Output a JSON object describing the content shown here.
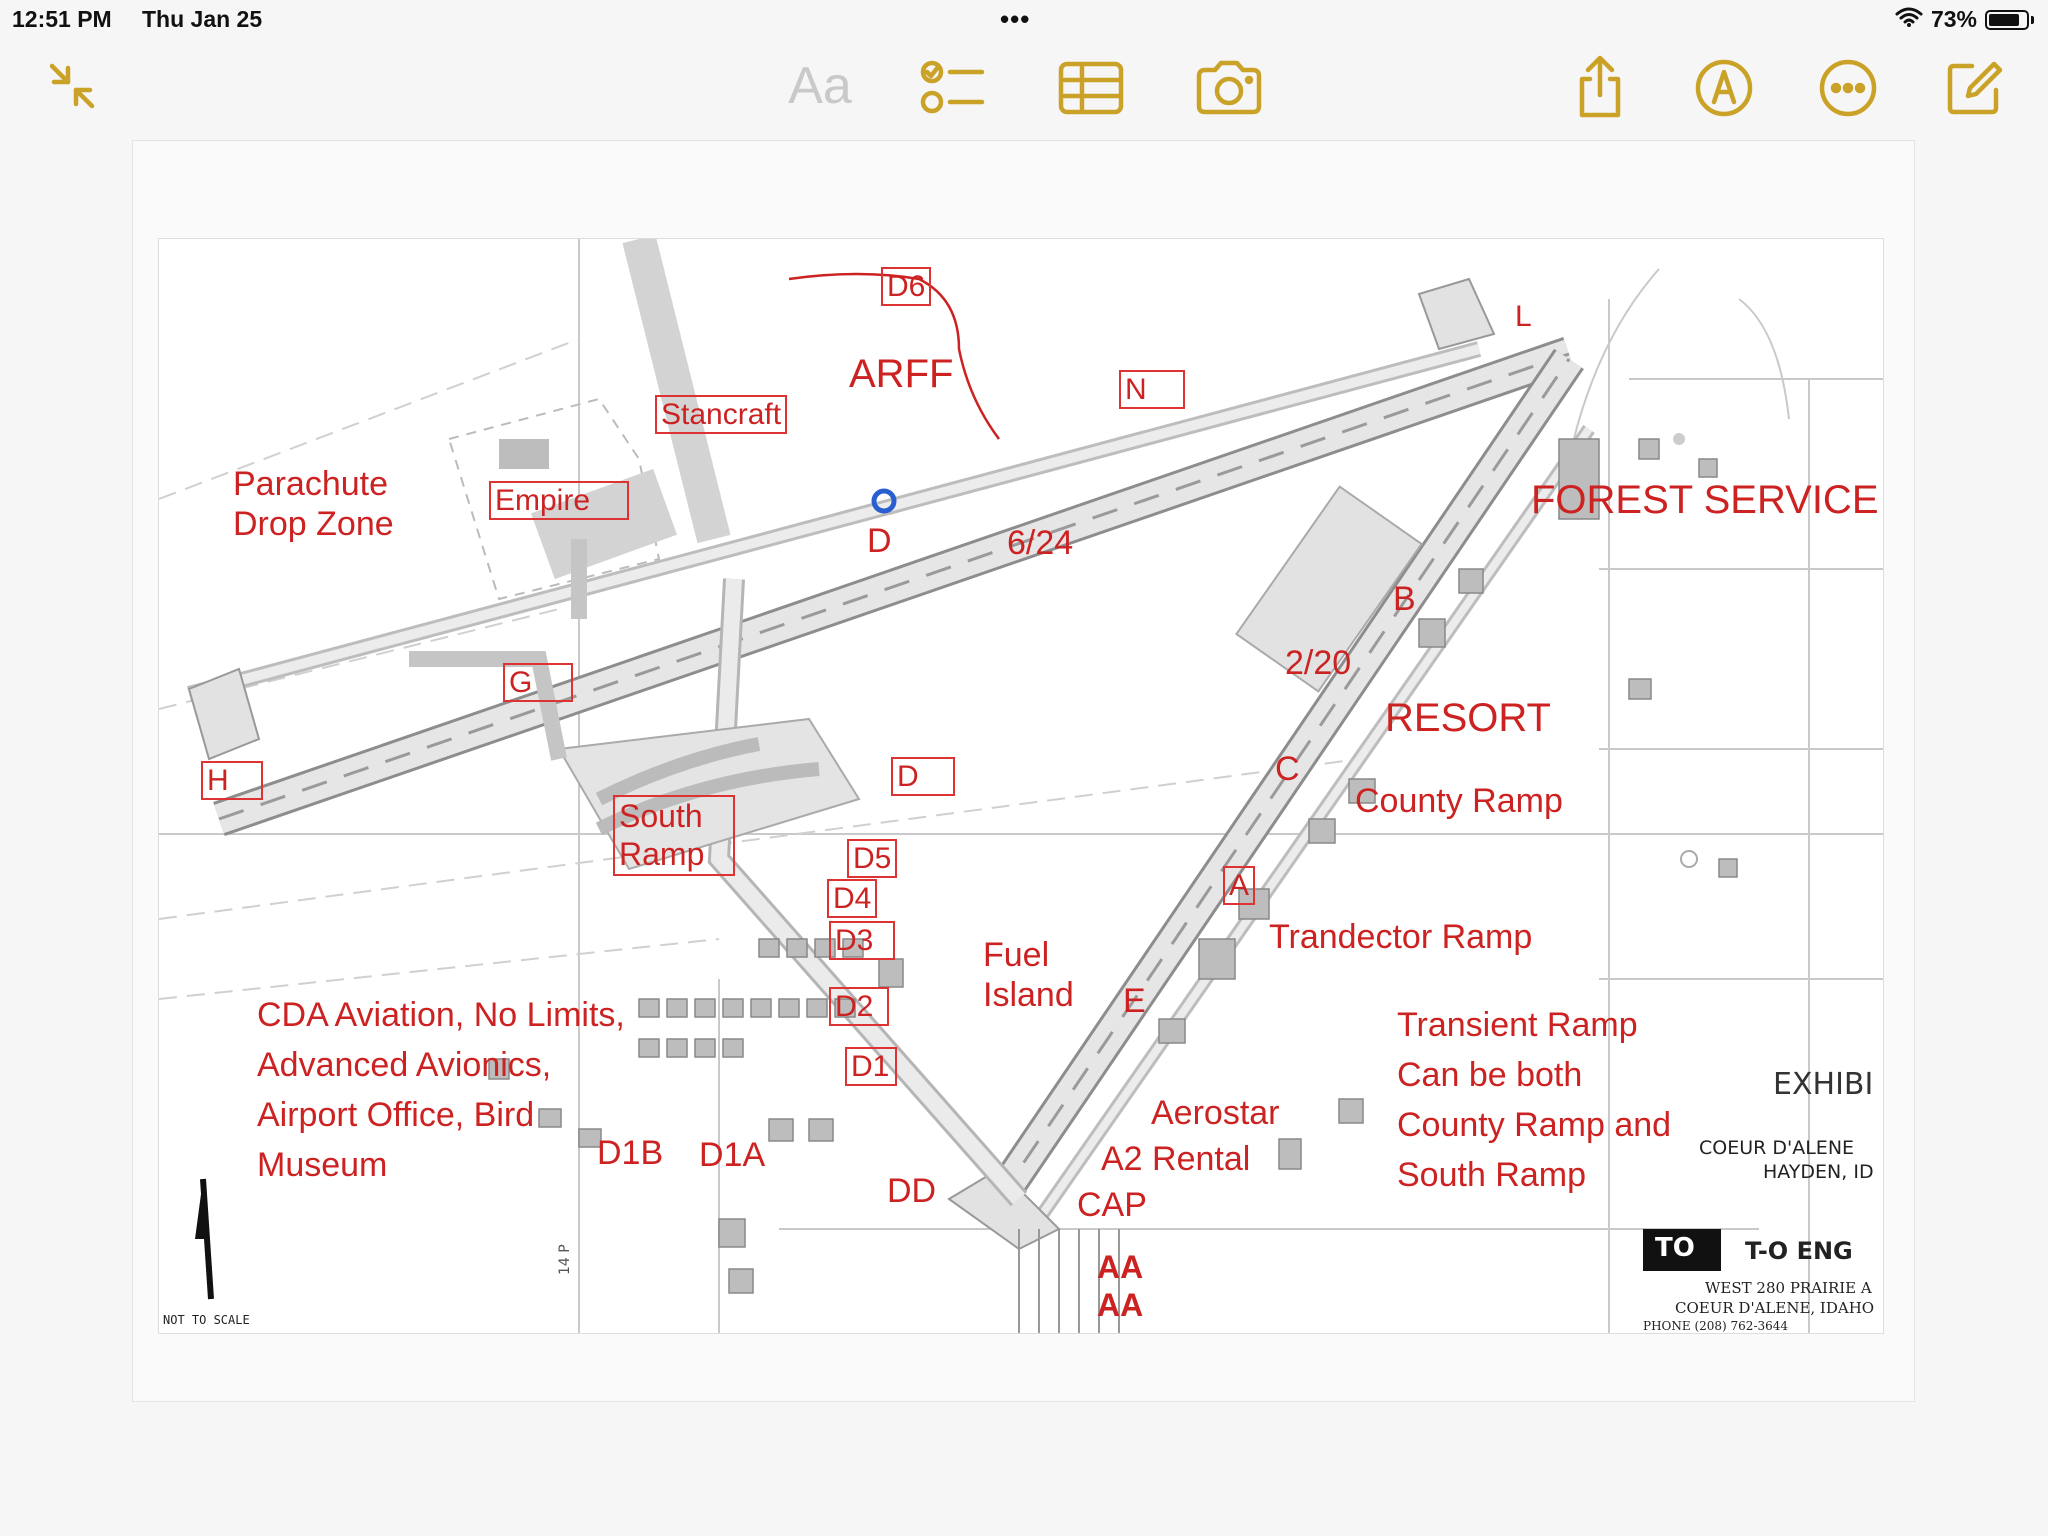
{
  "status": {
    "time": "12:51 PM",
    "date": "Thu Jan 25",
    "dots": "•••",
    "battery": "73%"
  },
  "toolbar": {
    "format_label": "Aa",
    "accent_color": "#c9a227"
  },
  "map": {
    "labels": {
      "d6": "D6",
      "arff": "ARFF",
      "n": "N",
      "l": "L",
      "stancraft": "Stancraft",
      "parachute": "Parachute\nDrop Zone",
      "empire": "Empire",
      "d_north": "D",
      "runway_6_24": "6/24",
      "forest_service": "FOREST SERVICE",
      "b": "B",
      "runway_2_20": "2/20",
      "g": "G",
      "resort": "RESORT",
      "h": "H",
      "d_south": "D",
      "c": "C",
      "south_ramp": "South\nRamp",
      "county_ramp": "County Ramp",
      "d5": "D5",
      "a": "A",
      "d4": "D4",
      "d3": "D3",
      "trandector_ramp": "Trandector Ramp",
      "fuel_island": "Fuel\nIsland",
      "e": "E",
      "cda_aviation": "CDA Aviation, No Limits,\nAdvanced Avionics,\nAirport Office, Bird\nMuseum",
      "d2": "D2",
      "transient_ramp": "Transient Ramp\nCan be both\nCounty Ramp and\nSouth Ramp",
      "d1": "D1",
      "aerostar": "Aerostar",
      "d1b": "D1B",
      "d1a": "D1A",
      "a2_rental": "A2 Rental",
      "dd": "DD",
      "cap": "CAP",
      "aa1": "AA",
      "aa2": "AA"
    },
    "printed": {
      "exhibit": "EXHIBI",
      "city1": "COEUR D'ALENE",
      "city2": "HAYDEN, ID",
      "logo_text": "TO",
      "company": "T-O ENG",
      "address1": "WEST 280 PRAIRIE A",
      "address2": "COEUR D'ALENE, IDAHO",
      "phone": "PHONE (208) 762-3644",
      "not_to_scale": "NOT TO SCALE",
      "street": "14 P"
    }
  }
}
